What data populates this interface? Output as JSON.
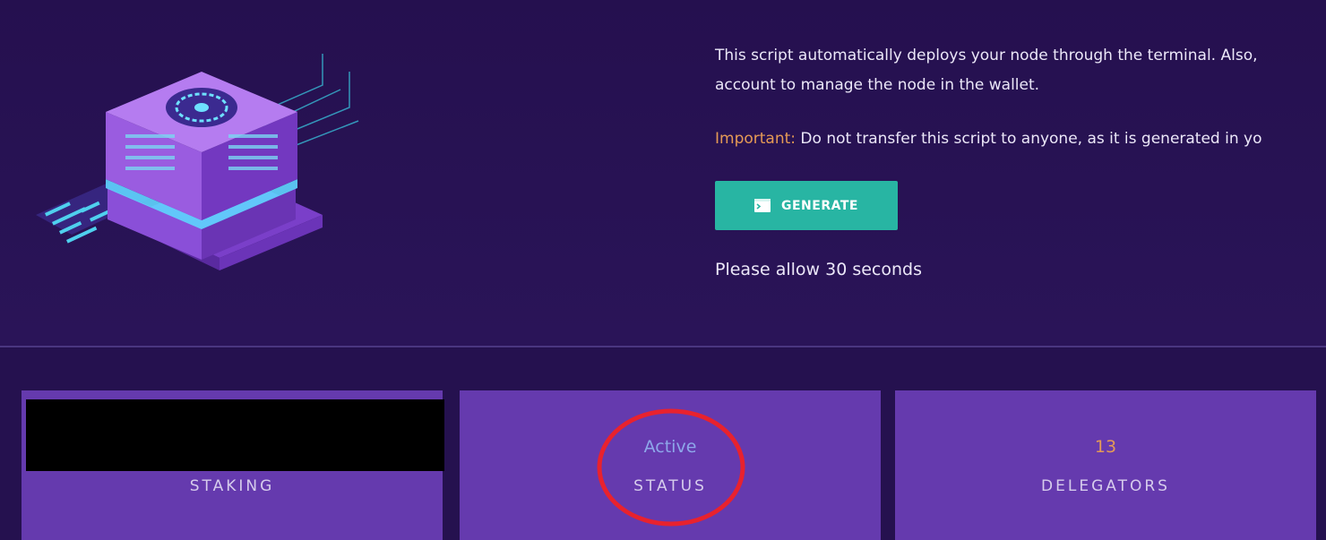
{
  "description": {
    "line1": "This script automatically deploys your node through the terminal. Also,",
    "line2": "account to manage the node in the wallet.",
    "important_label": "Important:",
    "important_text": " Do not transfer this script to anyone, as it is generated in yo"
  },
  "generate_button": {
    "icon": "terminal-icon",
    "label": "GENERATE"
  },
  "wait_text": "Please allow 30 seconds",
  "stats": {
    "staking": {
      "label": "STAKING",
      "value_redacted": true
    },
    "status": {
      "value": "Active",
      "label": "STATUS"
    },
    "delegators": {
      "value": "13",
      "label": "DELEGATORS"
    }
  },
  "colors": {
    "background": "#25114f",
    "card": "#653aae",
    "accent_button": "#28b5a3",
    "important": "#e59a55",
    "active_value": "#8ea8ea",
    "annotation": "#e8222e"
  }
}
